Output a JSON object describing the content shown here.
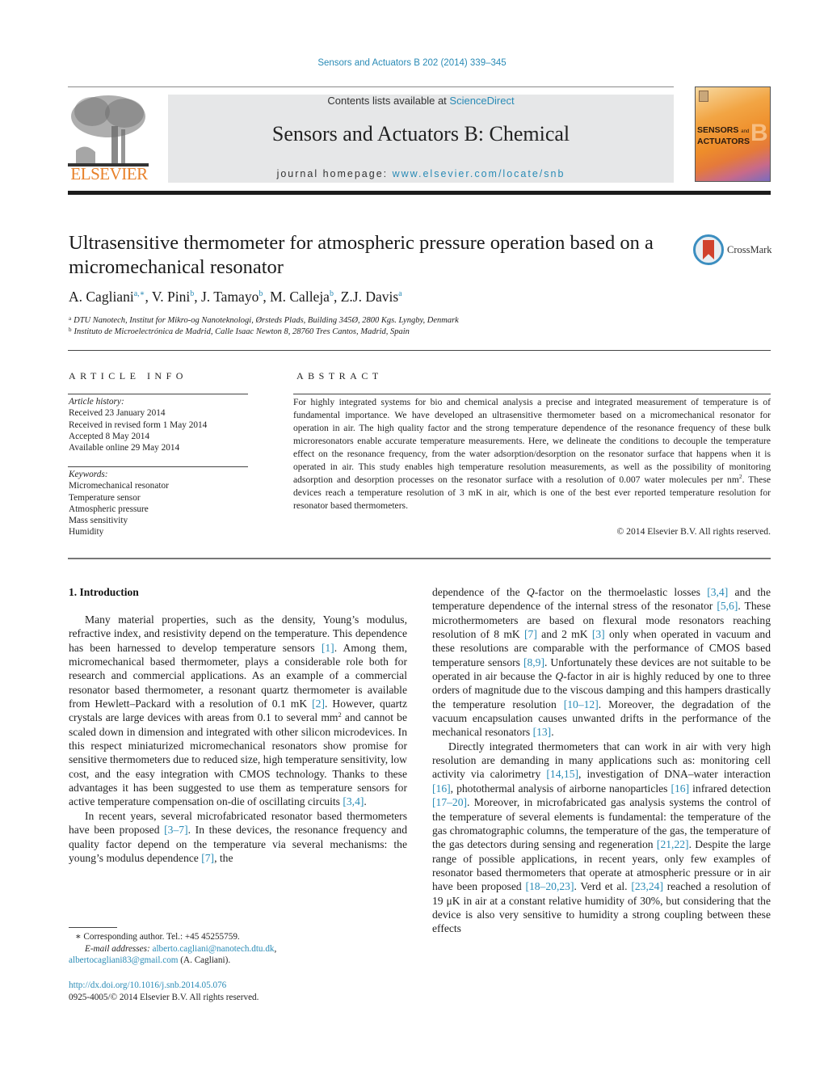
{
  "journal_ref": "Sensors and Actuators B 202 (2014) 339–345",
  "masthead": {
    "publisher_logo_text": "ELSEVIER",
    "contents_prefix": "Contents lists available at ",
    "contents_link": "ScienceDirect",
    "journal_title": "Sensors and Actuators B: Chemical",
    "homepage_prefix": "journal homepage: ",
    "homepage_link": "www.elsevier.com/locate/snb",
    "cover_text_line1": "SENSORS",
    "cover_text_and": "and",
    "cover_text_line2": "ACTUATORS",
    "cover_letter": "B"
  },
  "article": {
    "title": "Ultrasensitive thermometer for atmospheric pressure operation based on a micromechanical resonator",
    "crossmark_label": "CrossMark",
    "authors": [
      {
        "name": "A. Cagliani",
        "sup": "a,∗"
      },
      {
        "name": "V. Pini",
        "sup": "b"
      },
      {
        "name": "J. Tamayo",
        "sup": "b"
      },
      {
        "name": "M. Calleja",
        "sup": "b"
      },
      {
        "name": "Z.J. Davis",
        "sup": "a"
      }
    ],
    "affiliations": [
      {
        "mark": "a",
        "text": "DTU Nanotech, Institut for Mikro-og Nanoteknologi, Ørsteds Plads, Building 345Ø, 2800 Kgs. Lyngby, Denmark"
      },
      {
        "mark": "b",
        "text": "Instituto de Microelectrónica de Madrid, Calle Isaac Newton 8, 28760 Tres Cantos, Madrid, Spain"
      }
    ]
  },
  "article_info": {
    "heading": "ARTICLE INFO",
    "history_title": "Article history:",
    "history": [
      "Received 23 January 2014",
      "Received in revised form 1 May 2014",
      "Accepted 8 May 2014",
      "Available online 29 May 2014"
    ],
    "keywords_title": "Keywords:",
    "keywords": [
      "Micromechanical resonator",
      "Temperature sensor",
      "Atmospheric pressure",
      "Mass sensitivity",
      "Humidity"
    ]
  },
  "abstract": {
    "heading": "ABSTRACT",
    "text_part1": "For highly integrated systems for bio and chemical analysis a precise and integrated measurement of temperature is of fundamental importance. We have developed an ultrasensitive thermometer based on a micromechanical resonator for operation in air. The high quality factor and the strong temperature dependence of the resonance frequency of these bulk microresonators enable accurate temperature measurements. Here, we delineate the conditions to decouple the temperature effect on the resonance frequency, from the water adsorption/desorption on the resonator surface that happens when it is operated in air. This study enables high temperature resolution measurements, as well as the possibility of monitoring adsorption and desorption processes on the resonator surface with a resolution of 0.007 water molecules per nm",
    "text_sup": "2",
    "text_part2": ". These devices reach a temperature resolution of 3 mK in air, which is one of the best ever reported temperature resolution for resonator based thermometers.",
    "copyright": "© 2014 Elsevier B.V. All rights reserved."
  },
  "body": {
    "section_heading": "1.  Introduction",
    "left": {
      "p1": [
        {
          "t": "Many material properties, such as the density, Young’s modulus, refractive index, and resistivity depend on the temperature. This dependence has been harnessed to develop temperature sensors "
        },
        {
          "ref": "[1]"
        },
        {
          "t": ". Among them, micromechanical based thermometer, plays a considerable role both for research and commercial applications. As an example of a commercial resonator based thermometer, a resonant quartz thermometer is available from Hewlett–Packard with a resolution of 0.1 mK "
        },
        {
          "ref": "[2]"
        },
        {
          "t": ". However, quartz crystals are large devices with areas from 0.1 to several mm"
        },
        {
          "sup": "2"
        },
        {
          "t": " and cannot be scaled down in dimension and integrated with other silicon microdevices. In this respect miniaturized micromechanical resonators show promise for sensitive thermometers due to reduced size, high temperature sensitivity, low cost, and the easy integration with CMOS technology. Thanks to these advantages it has been suggested to use them as temperature sensors for active temperature compensation on-die of oscillating circuits "
        },
        {
          "ref": "[3,4]"
        },
        {
          "t": "."
        }
      ],
      "p2": [
        {
          "t": "In recent years, several microfabricated resonator based thermometers have been proposed "
        },
        {
          "ref": "[3–7]"
        },
        {
          "t": ". In these devices, the resonance frequency and quality factor depend on the temperature via several mechanisms: the young’s modulus dependence "
        },
        {
          "ref": "[7]"
        },
        {
          "t": ", the"
        }
      ]
    },
    "right": {
      "p1": [
        {
          "t": "dependence of the "
        },
        {
          "i": "Q"
        },
        {
          "t": "-factor on the thermoelastic losses "
        },
        {
          "ref": "[3,4]"
        },
        {
          "t": " and the temperature dependence of the internal stress of the resonator "
        },
        {
          "ref": "[5,6]"
        },
        {
          "t": ". These microthermometers are based on flexural mode resonators reaching resolution of 8 mK "
        },
        {
          "ref": "[7]"
        },
        {
          "t": " and 2 mK "
        },
        {
          "ref": "[3]"
        },
        {
          "t": " only when operated in vacuum and these resolutions are comparable with the performance of CMOS based temperature sensors "
        },
        {
          "ref": "[8,9]"
        },
        {
          "t": ". Unfortunately these devices are not suitable to be operated in air because the "
        },
        {
          "i": "Q"
        },
        {
          "t": "-factor in air is highly reduced by one to three orders of magnitude due to the viscous damping and this hampers drastically the temperature resolution "
        },
        {
          "ref": "[10–12]"
        },
        {
          "t": ". Moreover, the degradation of the vacuum encapsulation causes unwanted drifts in the performance of the mechanical resonators "
        },
        {
          "ref": "[13]"
        },
        {
          "t": "."
        }
      ],
      "p2": [
        {
          "t": "Directly integrated thermometers that can work in air with very high resolution are demanding in many applications such as: monitoring cell activity via calorimetry "
        },
        {
          "ref": "[14,15]"
        },
        {
          "t": ", investigation of DNA–water interaction "
        },
        {
          "ref": "[16]"
        },
        {
          "t": ", photothermal analysis of airborne nanoparticles "
        },
        {
          "ref": "[16]"
        },
        {
          "t": " infrared detection "
        },
        {
          "ref": "[17–20]"
        },
        {
          "t": ". Moreover, in microfabricated gas analysis systems the control of the temperature of several elements is fundamental: the temperature of the gas chromatographic columns, the temperature of the gas, the temperature of the gas detectors during sensing and regeneration "
        },
        {
          "ref": "[21,22]"
        },
        {
          "t": ". Despite the large range of possible applications, in recent years, only few examples of resonator based thermometers that operate at atmospheric pressure or in air have been proposed "
        },
        {
          "ref": "[18–20,23]"
        },
        {
          "t": ". Verd et al. "
        },
        {
          "ref": "[23,24]"
        },
        {
          "t": " reached a resolution of 19 μK in air at a constant relative humidity of 30%, but considering that the device is also very sensitive to humidity a strong coupling between these effects"
        }
      ]
    }
  },
  "footnotes": {
    "corresponding": "∗  Corresponding author. Tel.: +45 45255759.",
    "email_label": "E-mail addresses: ",
    "email1": "alberto.cagliani@nanotech.dtu.dk",
    "email_sep": ",",
    "email2": "albertocagliani83@gmail.com",
    "email_suffix": " (A. Cagliani).",
    "doi": "http://dx.doi.org/10.1016/j.snb.2014.05.076",
    "issn_copyright": "0925-4005/© 2014 Elsevier B.V. All rights reserved."
  }
}
